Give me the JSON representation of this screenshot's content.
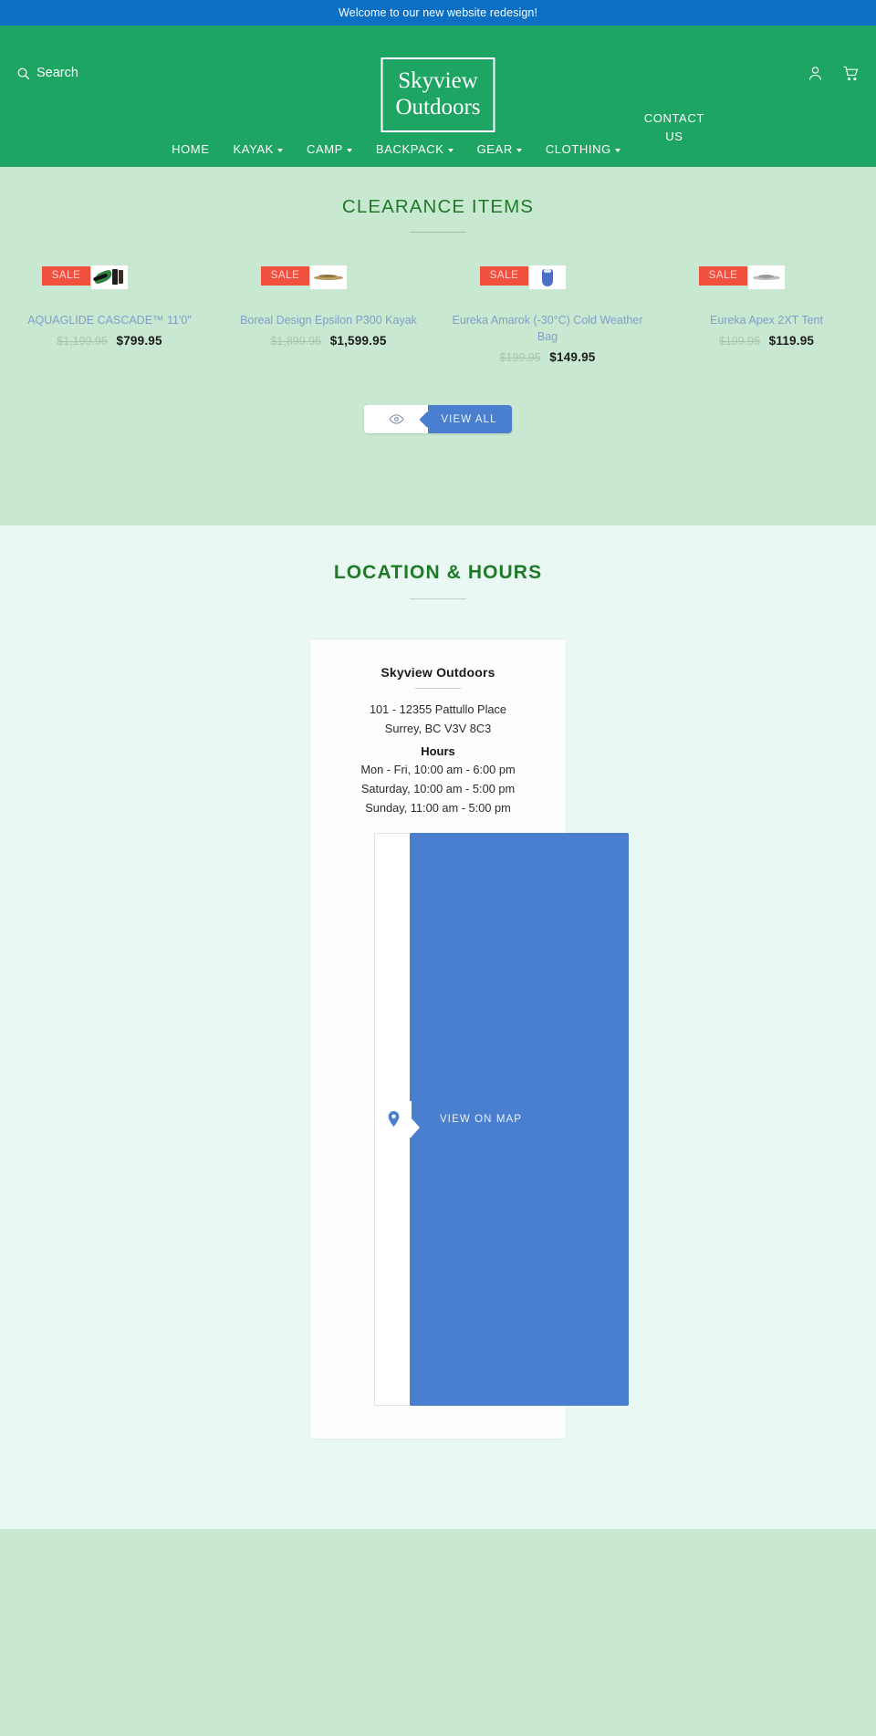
{
  "announcement": {
    "text": "Welcome to our new website redesign!",
    "bg": "#0b6fc4"
  },
  "header": {
    "bg": "#1ea463",
    "search_label": "Search",
    "search_icon": "search-icon",
    "account_icon": "user-icon",
    "cart_icon": "cart-icon",
    "logo": {
      "line1": "Skyview",
      "line2": "Outdoors"
    },
    "nav": [
      {
        "label": "HOME",
        "has_caret": false
      },
      {
        "label": "KAYAK",
        "has_caret": true
      },
      {
        "label": "CAMP",
        "has_caret": true
      },
      {
        "label": "BACKPACK",
        "has_caret": true
      },
      {
        "label": "GEAR",
        "has_caret": true
      },
      {
        "label": "CLOTHING",
        "has_caret": true
      },
      {
        "label": "CONTACT US",
        "has_caret": false,
        "line1": "CONTACT",
        "line2": "US"
      }
    ]
  },
  "clearance": {
    "bg": "#c9e8d1",
    "title": "CLEARANCE ITEMS",
    "badge_label": "SALE",
    "products": [
      {
        "title": "AQUAGLIDE CASCADE™ 11'0\"",
        "price_old": "$1,199.95",
        "price_new": "$799.95",
        "thumb": "kayak-paddle-thumbnail"
      },
      {
        "title": "Boreal Design Epsilon P300 Kayak",
        "price_old": "$1,899.95",
        "price_new": "$1,599.95",
        "thumb": "tan-kayak-thumbnail"
      },
      {
        "title": "Eureka Amarok (-30°C) Cold Weather Bag",
        "price_old": "$199.95",
        "price_new": "$149.95",
        "thumb": "sleeping-bag-thumbnail"
      },
      {
        "title": "Eureka Apex 2XT Tent",
        "price_old": "$199.95",
        "price_new": "$119.95",
        "thumb": "tent-thumbnail"
      }
    ],
    "view_all": {
      "label": "VIEW ALL",
      "icon": "eye-icon",
      "accent": "#4a7fd0"
    }
  },
  "location": {
    "bg": "#e9f8f2",
    "title": "LOCATION & HOURS",
    "store_name": "Skyview Outdoors",
    "address_line1": "101 - 12355 Pattullo Place",
    "address_line2": "Surrey, BC V3V 8C3",
    "hours_label": "Hours",
    "hours": [
      "Mon - Fri,  10:00 am - 6:00 pm",
      "Saturday,  10:00 am - 5:00 pm",
      "Sunday,  11:00 am - 5:00 pm"
    ],
    "map": {
      "button_label": "VIEW ON MAP",
      "pin_icon": "map-pin-icon",
      "accent": "#4a7fd0"
    }
  },
  "footer": {
    "bg": "#c9e8d1"
  }
}
